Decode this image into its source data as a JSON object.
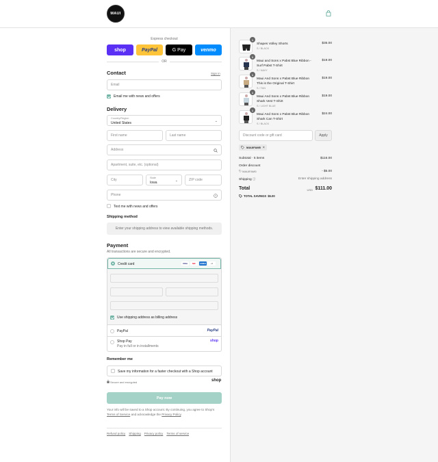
{
  "header": {
    "logo_text": "MAUI",
    "cart_icon": "shopping-bag-icon"
  },
  "express": {
    "label": "Express checkout",
    "buttons": [
      "shop",
      "PayPal",
      "G Pay",
      "venmo"
    ],
    "or": "OR"
  },
  "contact": {
    "title": "Contact",
    "signin": "Sign in",
    "email_placeholder": "Email",
    "email_optin": "Email me with news and offers"
  },
  "delivery": {
    "title": "Delivery",
    "country_label": "Country/Region",
    "country": "United States",
    "first_name": "First name",
    "last_name": "Last name",
    "address": "Address",
    "apartment": "Apartment, suite, etc. (optional)",
    "city": "City",
    "state_label": "State",
    "state": "Iowa",
    "zip": "ZIP code",
    "phone": "Phone",
    "text_optin": "Text me with news and offers"
  },
  "shipping": {
    "title": "Shipping method",
    "info": "Enter your shipping address to view available shipping methods."
  },
  "payment": {
    "title": "Payment",
    "subtitle": "All transactions are secure and encrypted.",
    "credit_card": "Credit card",
    "card_logos": [
      "VISA",
      "MC",
      "AMEX",
      "+5"
    ],
    "billing_same": "Use shipping address as billing address",
    "paypal": "PayPal",
    "paypal_logo": "PayPal",
    "shoppay": "Shop Pay",
    "shoppay_sub": "Pay in full or in installments",
    "shoppay_logo": "shop"
  },
  "remember": {
    "title": "Remember me",
    "save_info": "Save my information for a faster checkout with a Shop account",
    "secure": "Secure and encrypted",
    "shop_logo": "shop"
  },
  "pay_now": "Pay now",
  "footnote": {
    "pre": "Your info will be saved to a Shop account. By continuing, you agree to Shop's ",
    "terms": "Terms of Service",
    "mid": " and acknowledge the ",
    "privacy": "Privacy Policy",
    "post": "."
  },
  "footer_links": [
    "Refund policy",
    "Shipping",
    "Privacy policy",
    "Terms of service"
  ],
  "cart": {
    "items": [
      {
        "qty": "1",
        "name": "Shapes Volley Shorts",
        "variant": "S / BLACK",
        "price": "$35.00"
      },
      {
        "qty": "1",
        "name": "Maui and Sons x Pabst Blue Ribbon - Surf Pabst T-Shirt",
        "variant": "S / NAVY",
        "price": "$19.00"
      },
      {
        "qty": "1",
        "name": "Maui And Sons x Pabst Blue Ribbon This is the Original T-Shirt",
        "variant": "S / TAN",
        "price": "$19.00"
      },
      {
        "qty": "1",
        "name": "Maui And Sons x Pabst Blue Ribbon Shark Vest T-Shirt",
        "variant": "S / LIGHT BLUE",
        "price": "$19.00"
      },
      {
        "qty": "1",
        "name": "Maui And Sons x Pabst Blue Ribbon Shark Can T-Shirt",
        "variant": "S / BLACK",
        "price": "$24.00"
      }
    ],
    "discount_placeholder": "Discount code or gift card",
    "apply": "Apply",
    "applied_code": "MAUIFAM5",
    "subtotal_label": "Subtotal · 5 items",
    "subtotal": "$116.00",
    "order_discount_label": "Order discount",
    "discount_code": "MAUIFAM5",
    "discount_value": "- $5.00",
    "shipping_label": "Shipping",
    "shipping_value": "Enter shipping address",
    "total_label": "Total",
    "currency": "USD",
    "total": "$111.00",
    "savings_label": "TOTAL SAVINGS",
    "savings": "$5.00"
  }
}
